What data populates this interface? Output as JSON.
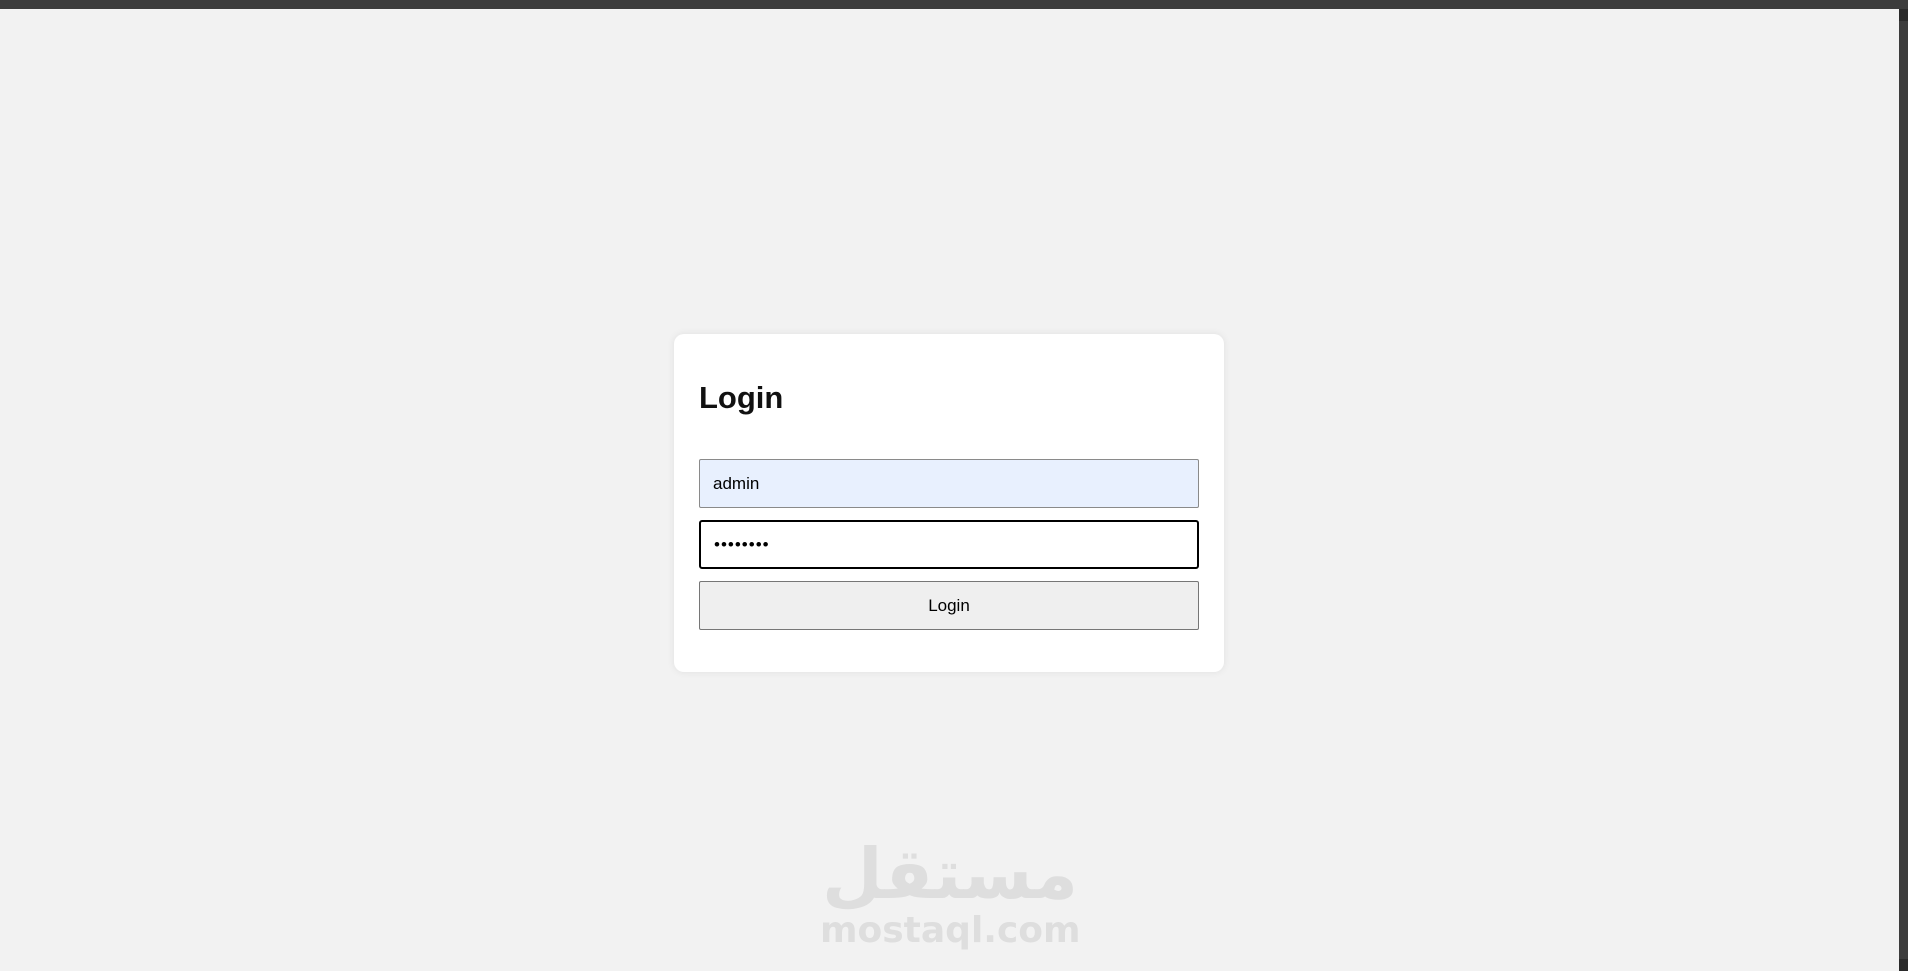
{
  "login": {
    "title": "Login",
    "username_value": "admin",
    "password_value": "••••••••",
    "button_label": "Login"
  },
  "watermark": {
    "arabic_text": "مستقل",
    "latin_text": "mostaql.com"
  },
  "colors": {
    "page_background": "#f2f2f2",
    "card_background": "#ffffff",
    "username_background": "#e8f0fe",
    "button_background": "#efefef",
    "top_bar": "#3c3c3c"
  }
}
